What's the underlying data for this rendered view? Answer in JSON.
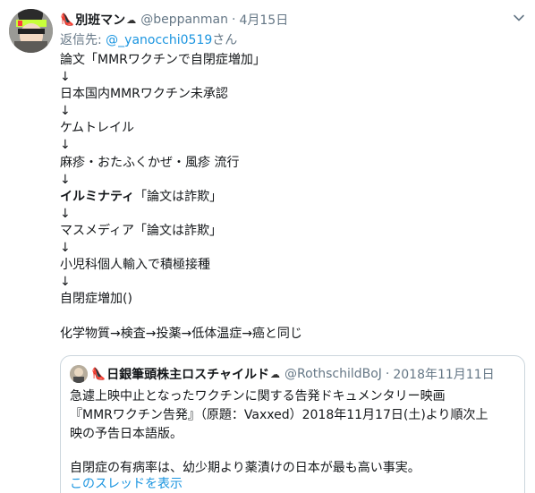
{
  "tweet": {
    "name_emoji": "👠",
    "display_name": "別班マン",
    "name_suffix": "☁",
    "handle": "@beppanman",
    "separator": "·",
    "date": "4月15日",
    "reply_prefix": "返信先: ",
    "reply_handle": "@_yanocchi0519",
    "reply_suffix": "さん",
    "lines": [
      {
        "text": "論文「MMRワクチンで自閉症増加」"
      },
      {
        "text": "↓"
      },
      {
        "text": "日本国内MMRワクチン未承認"
      },
      {
        "text": "↓"
      },
      {
        "text": "ケムトレイル"
      },
      {
        "text": "↓"
      },
      {
        "text": "麻疹・おたふくかぜ・風疹 流行"
      },
      {
        "text": "↓"
      },
      {
        "bold": "イルミナティ",
        "text": "「論文は詐欺」"
      },
      {
        "text": "↓"
      },
      {
        "text": "マスメディア「論文は詐欺」"
      },
      {
        "text": "↓"
      },
      {
        "text": "小児科個人輸入で積極接種"
      },
      {
        "text": "↓"
      },
      {
        "text": "自閉症増加()"
      },
      {
        "text": ""
      },
      {
        "text": "化学物質→検査→投薬→低体温症→癌と同じ"
      }
    ]
  },
  "quoted": {
    "name_emoji": "👠",
    "display_name": "日銀筆頭株主ロスチャイルド",
    "name_suffix": "☁",
    "handle": "@RothschildBoJ",
    "separator": "·",
    "date": "2018年11月11日",
    "lines": [
      "急遽上映中止となったワクチンに関する告発ドキュメンタリー映画",
      "『MMRワクチン告発』（原題：Vaxxed）2018年11月17日(土)より順次上",
      "映の予告日本語版。",
      "",
      "自閉症の有病率は、幼少期より薬漬けの日本が最も高い事実。"
    ],
    "thread_link": "このスレッドを表示"
  },
  "colors": {
    "link": "#1b95e0",
    "muted": "#657786",
    "text": "#14171a",
    "border": "#ccd6dd"
  },
  "icons": {
    "menu": "chevron-down-icon"
  }
}
